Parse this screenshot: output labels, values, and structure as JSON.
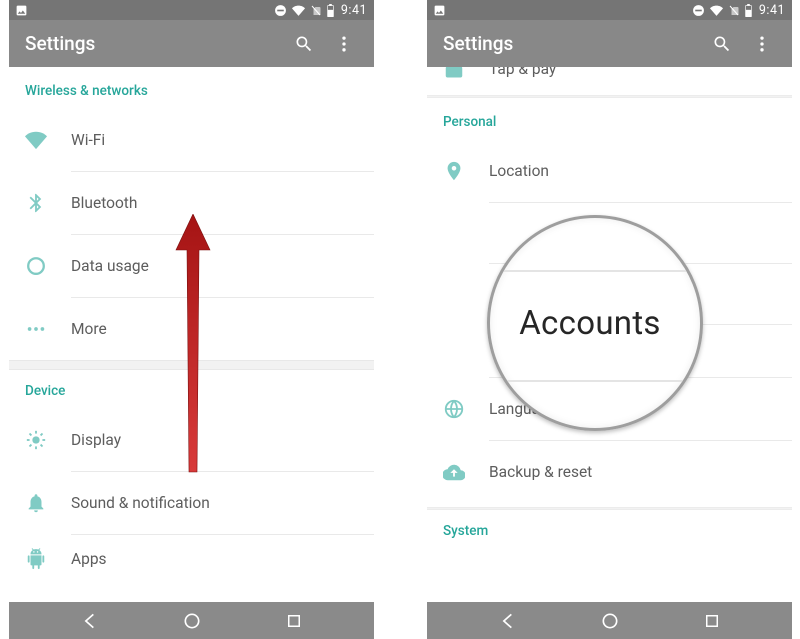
{
  "status": {
    "time": "9:41"
  },
  "appbar": {
    "title": "Settings"
  },
  "left": {
    "section_wireless": "Wireless & networks",
    "wifi": "Wi-Fi",
    "bluetooth": "Bluetooth",
    "data_usage": "Data usage",
    "more": "More",
    "section_device": "Device",
    "display": "Display",
    "sound": "Sound & notification",
    "apps": "Apps"
  },
  "right": {
    "tap_pay": "Tap & pay",
    "section_personal": "Personal",
    "location": "Location",
    "accounts_zoom": "Accounts",
    "language": "Language & input",
    "backup": "Backup & reset",
    "section_system": "System"
  }
}
